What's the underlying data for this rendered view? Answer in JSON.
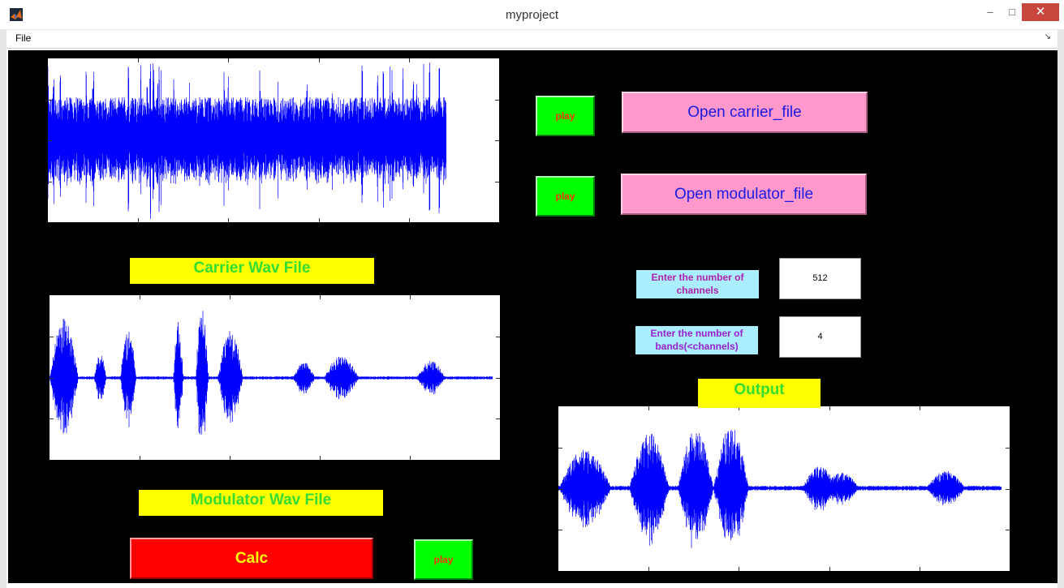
{
  "window": {
    "title": "myproject",
    "min_glyph": "–",
    "max_glyph": "□",
    "close_glyph": "✕"
  },
  "menu": {
    "file": "File",
    "right_glyph": "↘"
  },
  "carrier": {
    "play": "play",
    "open": "Open carrier_file",
    "label": "Carrier Wav File"
  },
  "modulator": {
    "play": "play",
    "open": "Open modulator_file",
    "label": "Modulator Wav File"
  },
  "channels": {
    "label": "Enter the number of channels",
    "value": "512"
  },
  "bands": {
    "label": "Enter the number of bands(<channels)",
    "value": "4"
  },
  "output": {
    "label": "Output",
    "play": "play"
  },
  "calc": {
    "label": "Calc"
  },
  "colors": {
    "signal": "#0000ff",
    "play_bg": "#00ff00",
    "play_text": "#ff3300",
    "open_bg": "#ff99cc",
    "label_bg": "#ffff00",
    "label_text": "#33dd33",
    "calc_bg": "#ff0000",
    "calc_text": "#ffff00"
  },
  "icons": {
    "app": "matlab-icon"
  }
}
